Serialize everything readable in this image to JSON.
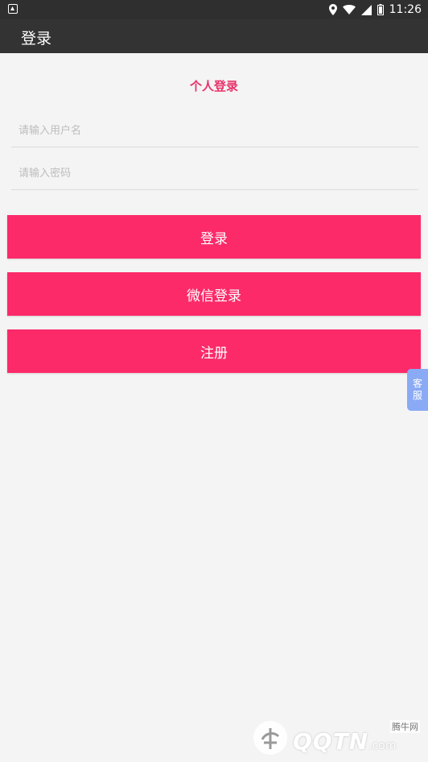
{
  "status_bar": {
    "time": "11:26"
  },
  "app_bar": {
    "title": "登录"
  },
  "form": {
    "section_title": "个人登录",
    "username_placeholder": "请输入用户名",
    "password_placeholder": "请输入密码",
    "username_value": "",
    "password_value": ""
  },
  "buttons": {
    "login": "登录",
    "wechat_login": "微信登录",
    "register": "注册"
  },
  "customer_service": {
    "line1": "客",
    "line2": "服"
  },
  "watermark": {
    "brand": "QQTN",
    "suffix": ".com",
    "cn_name": "腾牛网"
  },
  "colors": {
    "accent": "#fc2a69",
    "title_accent": "#e8336a",
    "app_bar": "#333333",
    "status_bar": "#2f2f2f",
    "cs_tab": "#8aaaf5",
    "background": "#f4f4f4"
  },
  "icons": {
    "status_left": "notification-icon",
    "location": "location-icon",
    "wifi": "wifi-icon",
    "signal": "signal-icon",
    "battery": "battery-icon"
  }
}
